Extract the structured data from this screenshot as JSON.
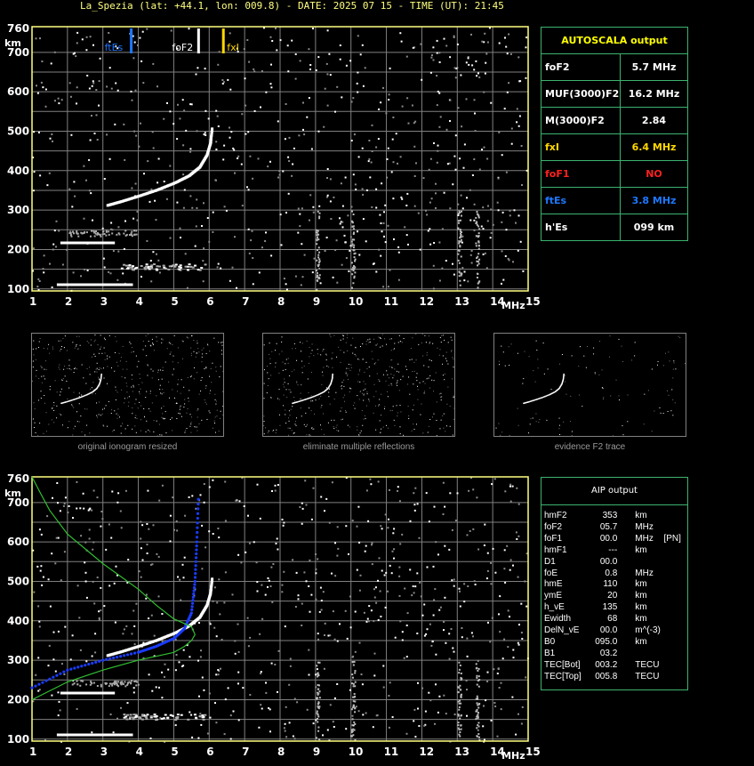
{
  "title": "La_Spezia (lat: +44.1, lon: 009.8) - DATE: 2025 07 15 - TIME (UT): 21:45",
  "colors": {
    "axis": "#ffff80",
    "grid": "#808080",
    "fEs": "#1e78ff",
    "fxI": "#ffd700",
    "green": "#30c030",
    "blue": "#1a3cff",
    "red": "#ff2020"
  },
  "axes": {
    "y_unit": "km",
    "x_unit": "MHz",
    "x_ticks": [
      "1",
      "2",
      "3",
      "4",
      "5",
      "6",
      "7",
      "8",
      "9",
      "10",
      "11",
      "12",
      "13",
      "14",
      "15"
    ],
    "y_ticks": [
      "760",
      "700",
      "600",
      "500",
      "400",
      "300",
      "200",
      "100"
    ]
  },
  "markers": [
    {
      "label": "ftEs",
      "freq": 3.8,
      "color": "#1e78ff"
    },
    {
      "label": "foF2",
      "freq": 5.7,
      "color": "#ffffff"
    },
    {
      "label": "fxI",
      "freq": 6.4,
      "color": "#ffd700"
    }
  ],
  "autoscala": {
    "title": "AUTOSCALA output",
    "rows": [
      {
        "key": "foF2",
        "value": "5.7 MHz",
        "kc": "#ffffff",
        "vc": "#ffffff"
      },
      {
        "key": "MUF(3000)F2",
        "value": "16.2 MHz",
        "kc": "#ffffff",
        "vc": "#ffffff"
      },
      {
        "key": "M(3000)F2",
        "value": "2.84",
        "kc": "#ffffff",
        "vc": "#ffffff"
      },
      {
        "key": "fxI",
        "value": "6.4 MHz",
        "kc": "#ffd700",
        "vc": "#ffd700"
      },
      {
        "key": "foF1",
        "value": "NO",
        "kc": "#ff2020",
        "vc": "#ff2020"
      },
      {
        "key": "ftEs",
        "value": "3.8 MHz",
        "kc": "#1e78ff",
        "vc": "#1e78ff"
      },
      {
        "key": "h'Es",
        "value": "099     km",
        "kc": "#ffffff",
        "vc": "#ffffff"
      }
    ]
  },
  "thumbs": [
    {
      "caption": "original ionogram resized"
    },
    {
      "caption": "eliminate multiple reflections"
    },
    {
      "caption": "evidence F2 trace"
    }
  ],
  "aip": {
    "title": "AIP output",
    "rows": [
      [
        "hmF2",
        "353",
        "km",
        ""
      ],
      [
        "foF2",
        "05.7",
        "MHz",
        ""
      ],
      [
        "foF1",
        "00.0",
        "MHz",
        "[PN]"
      ],
      [
        "hmF1",
        "---",
        "km",
        ""
      ],
      [
        "D1",
        "00.0",
        "",
        ""
      ],
      [
        "foE",
        "0.8",
        "MHz",
        ""
      ],
      [
        "hmE",
        "110",
        "km",
        ""
      ],
      [
        "ymE",
        "20",
        "km",
        ""
      ],
      [
        "h_vE",
        "135",
        "km",
        ""
      ],
      [
        "Ewidth",
        "68",
        "km",
        ""
      ],
      [
        "DelN_vE",
        "00.0",
        "m^(-3)",
        ""
      ],
      [
        "B0",
        "095.0",
        "km",
        ""
      ],
      [
        "B1",
        "03.2",
        "",
        ""
      ],
      [
        "TEC[Bot]",
        "003.2",
        "TECU",
        ""
      ],
      [
        "TEC[Top]",
        "005.8",
        "TECU",
        ""
      ]
    ]
  },
  "chart_data": [
    {
      "type": "scatter",
      "title": "La_Spezia (lat: +44.1, lon: 009.8) - DATE: 2025 07 15 - TIME (UT): 21:45",
      "xlabel": "MHz",
      "ylabel": "km",
      "xlim": [
        1,
        15
      ],
      "ylim": [
        95,
        765
      ],
      "grid": true,
      "series": [
        {
          "name": "",
          "x": [
            3.1,
            3.5,
            4.0,
            4.5,
            5.0,
            5.4,
            5.7,
            5.9,
            6.0,
            6.05
          ],
          "y": [
            313,
            323,
            337,
            352,
            370,
            388,
            410,
            440,
            470,
            510
          ]
        },
        {
          "name": "",
          "x": [
            1.7,
            2.0,
            2.5,
            3.0,
            3.4,
            3.8
          ],
          "y": [
            112,
            112,
            112,
            112,
            112,
            112
          ]
        },
        {
          "name": "",
          "x": [
            1.8,
            2.2,
            2.8,
            3.3
          ],
          "y": [
            218,
            218,
            218,
            218
          ]
        }
      ]
    },
    {
      "type": "line",
      "xlabel": "MHz",
      "ylabel": "km",
      "xlim": [
        1,
        15
      ],
      "ylim": [
        95,
        765
      ],
      "grid": true,
      "series": [
        {
          "name": "",
          "x": [
            1.0,
            2.0,
            3.0,
            4.0,
            4.5,
            5.0,
            5.3,
            5.5,
            5.6,
            5.65,
            5.7
          ],
          "y": [
            230,
            275,
            300,
            320,
            335,
            355,
            380,
            420,
            500,
            600,
            720
          ]
        },
        {
          "name": "",
          "x": [
            1.0,
            2.0,
            3.0,
            4.0,
            4.5,
            5.0,
            5.3,
            5.5,
            5.6,
            5.5,
            5.0,
            4.5,
            4.0,
            3.0,
            2.0,
            1.5,
            1.2,
            1.0
          ],
          "y": [
            200,
            245,
            275,
            300,
            310,
            320,
            335,
            350,
            365,
            385,
            405,
            440,
            480,
            545,
            620,
            680,
            730,
            765
          ]
        }
      ]
    }
  ]
}
